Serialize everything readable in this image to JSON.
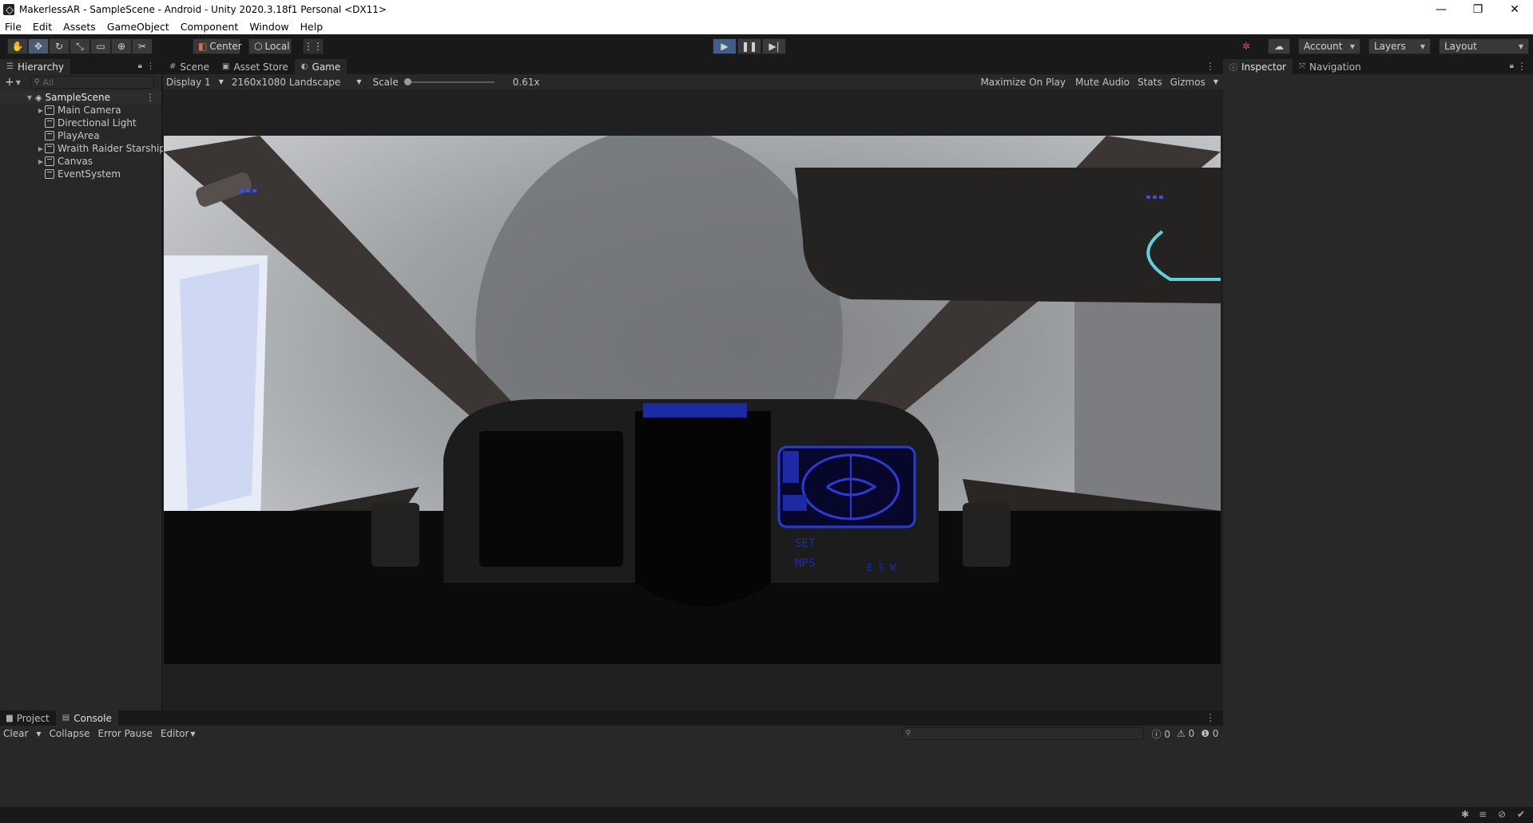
{
  "window": {
    "title": "MakerlessAR - SampleScene - Android - Unity 2020.3.18f1 Personal <DX11>",
    "controls": [
      "—",
      "❐",
      "✕"
    ]
  },
  "menu": [
    "File",
    "Edit",
    "Assets",
    "GameObject",
    "Component",
    "Window",
    "Help"
  ],
  "toolbar": {
    "pivot": "Center",
    "space": "Local",
    "account": "Account",
    "layers": "Layers",
    "layout": "Layout"
  },
  "hierarchy": {
    "tab": "Hierarchy",
    "search_placeholder": "All",
    "scene": "SampleScene",
    "items": [
      {
        "label": "Main Camera",
        "expandable": true
      },
      {
        "label": "Directional Light",
        "expandable": false
      },
      {
        "label": "PlayArea",
        "expandable": false
      },
      {
        "label": "Wraith Raider Starship",
        "expandable": true
      },
      {
        "label": "Canvas",
        "expandable": true
      },
      {
        "label": "EventSystem",
        "expandable": false
      }
    ]
  },
  "center_tabs": [
    "Scene",
    "Asset Store",
    "Game"
  ],
  "game": {
    "display": "Display 1",
    "resolution": "2160x1080 Landscape",
    "scale_label": "Scale",
    "scale_value": "0.61x",
    "maximize": "Maximize On Play",
    "mute": "Mute Audio",
    "stats": "Stats",
    "gizmos": "Gizmos",
    "hud_text": [
      "SET",
      "MPS",
      "E S W"
    ]
  },
  "right_tabs": [
    "Inspector",
    "Navigation"
  ],
  "bottom_tabs": [
    "Project",
    "Console"
  ],
  "console": {
    "clear": "Clear",
    "collapse": "Collapse",
    "error_pause": "Error Pause",
    "editor": "Editor",
    "counts": [
      "0",
      "0",
      "0"
    ]
  },
  "colors": {
    "accent": "#4a5a72",
    "panel": "#282828",
    "dark": "#191919",
    "hud_blue": "#2b3bd9"
  }
}
